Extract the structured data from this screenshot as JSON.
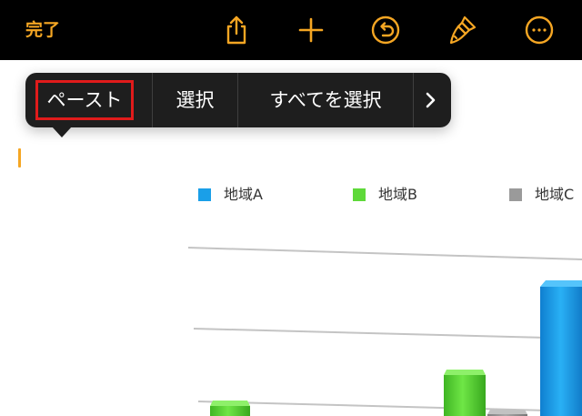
{
  "toolbar": {
    "done_label": "完了",
    "icons": [
      "share-icon",
      "add-icon",
      "undo-icon",
      "format-brush-icon",
      "more-icon"
    ],
    "accent": "#f5a623",
    "background": "#000000"
  },
  "popup_menu": {
    "items": [
      {
        "label": "ペースト",
        "highlighted": true
      },
      {
        "label": "選択"
      },
      {
        "label": "すべてを選択"
      }
    ],
    "next_icon": "chevron-right-icon",
    "background": "#1e1e1e",
    "highlight_color": "#e01b1b"
  },
  "chart_data": {
    "type": "bar",
    "style": "3d",
    "legend_position": "top",
    "grid": true,
    "series": [
      {
        "name": "地域A",
        "color": "#1a9fe8"
      },
      {
        "name": "地域B",
        "color": "#5fd93a"
      },
      {
        "name": "地域C",
        "color": "#9a9a9a"
      }
    ]
  }
}
